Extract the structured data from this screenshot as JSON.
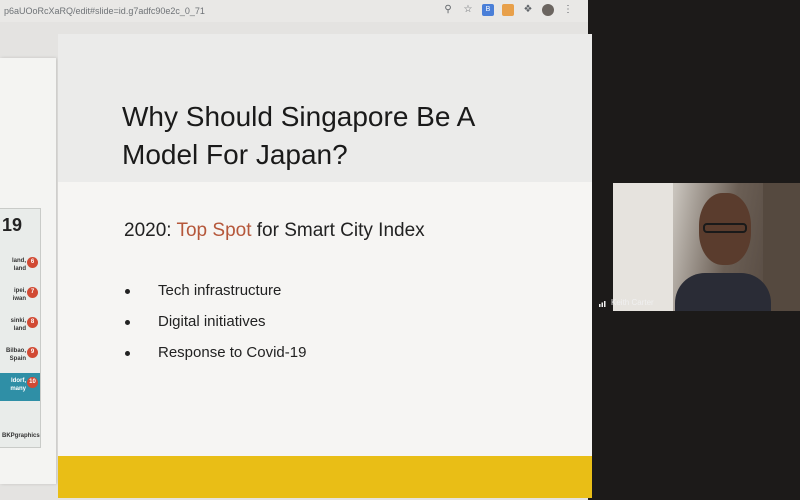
{
  "browser": {
    "url": "p6aUOoRcXaRQ/edit#slide=id.g7adfc90e2c_0_71",
    "icons": [
      "zoom-icon",
      "star-icon",
      "extension-icon",
      "metamask-icon",
      "puzzle-icon",
      "profile-icon",
      "menu-icon"
    ]
  },
  "thumbnail": {
    "year": "19",
    "rows": [
      {
        "text": "land,\nland",
        "rank": "6"
      },
      {
        "text": "ipei,\niwan",
        "rank": "7"
      },
      {
        "text": "sinki,\nland",
        "rank": "8"
      },
      {
        "text": "Bilbao,\nSpain",
        "rank": "9"
      },
      {
        "text": "ldorf,\nmany",
        "rank": "10"
      }
    ],
    "brand": "BKPgraphics"
  },
  "slide": {
    "title_line1": "Why Should Singapore Be A",
    "title_line2": "Model For Japan?",
    "subtitle_prefix": "2020: ",
    "subtitle_highlight": "Top Spot",
    "subtitle_suffix": " for Smart City Index",
    "bullets": [
      "Tech infrastructure",
      "Digital initiatives",
      "Response to Covid-19"
    ],
    "accent_color": "#e9be16",
    "highlight_color": "#b5573a"
  },
  "video": {
    "participant_name": "Keith Carter"
  }
}
